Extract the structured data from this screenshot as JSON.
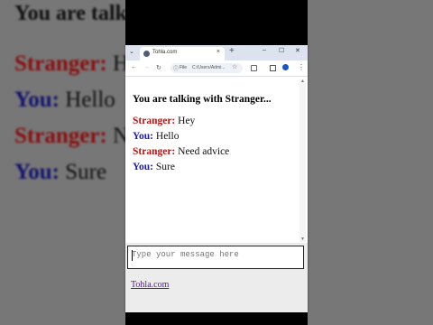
{
  "background": {
    "title": "You are talking with Stranger...",
    "lines": [
      {
        "speaker": "Stranger:",
        "text": " Hey"
      },
      {
        "speaker": "You:",
        "text": " Hello"
      },
      {
        "speaker": "Stranger:",
        "text": " Need advice"
      },
      {
        "speaker": "You:",
        "text": " Sure"
      }
    ]
  },
  "browser": {
    "tab_title": "Tohla.com",
    "tab_menu_icon": "chevron-down-icon",
    "new_tab_label": "+",
    "close_tab_label": "×",
    "window_controls": [
      "–",
      "☐",
      "✕"
    ],
    "omnibox": {
      "label": "File",
      "url": "C:/Users/Admi..."
    }
  },
  "chat": {
    "title": "You are talking with Stranger...",
    "messages": [
      {
        "speaker": "Stranger:",
        "text": " Hey"
      },
      {
        "speaker": "You:",
        "text": " Hello"
      },
      {
        "speaker": "Stranger:",
        "text": " Need advice"
      },
      {
        "speaker": "You:",
        "text": " Sure"
      }
    ],
    "input_placeholder": "Type your message here",
    "footer_link": "Tohla.com"
  },
  "colors": {
    "stranger": "#b81414",
    "you": "#1a1aa3",
    "link": "#551a8b"
  }
}
